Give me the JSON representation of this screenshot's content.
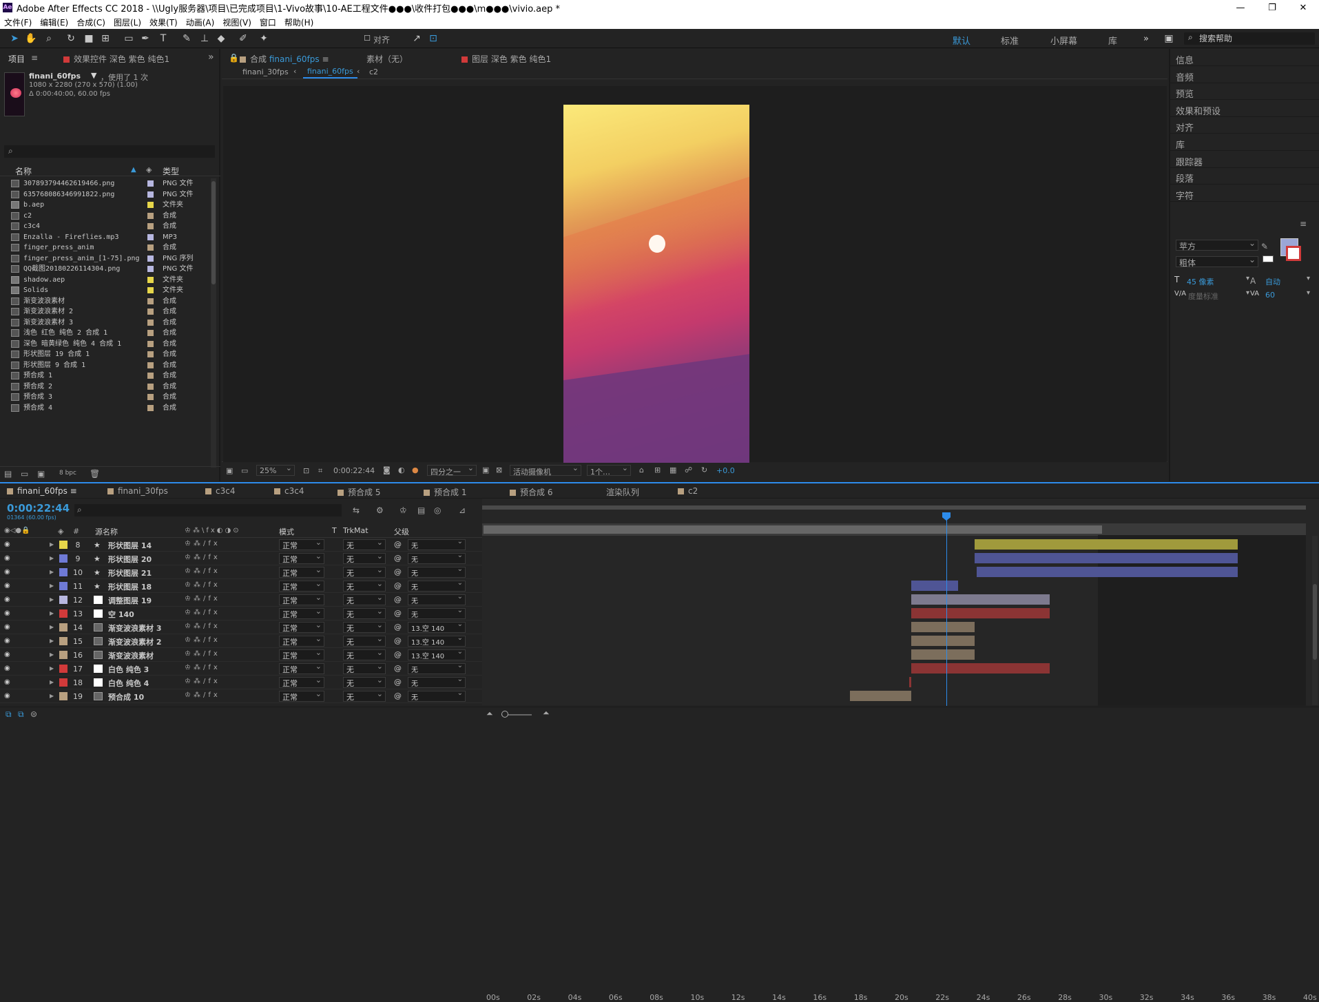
{
  "window": {
    "title": "Adobe After Effects CC 2018 - \\\\Ugly服务器\\项目\\已完成项目\\1-Vivo故事\\10-AE工程文件●●●\\收件打包●●●\\m●●●\\vivio.aep *",
    "logo": "Ae",
    "minimize": "—",
    "maximize": "❐",
    "close": "✕"
  },
  "menu": [
    "文件(F)",
    "编辑(E)",
    "合成(C)",
    "图层(L)",
    "效果(T)",
    "动画(A)",
    "视图(V)",
    "窗口",
    "帮助(H)"
  ],
  "toolbar": {
    "align_label": "对齐",
    "workspaces": [
      "默认",
      "标准",
      "小屏幕",
      "库"
    ],
    "active_workspace": "默认",
    "search_placeholder": "搜索帮助"
  },
  "project_panel": {
    "tab": "项目",
    "effects_tab": "效果控件 深色 紫色 纯色1",
    "item_name": "finani_60fps",
    "item_used": "，使用了 1 次",
    "item_dims": "1080 x 2280 (270 x 570) (1.00)",
    "item_time": "Δ 0:00:40:00, 60.00 fps",
    "col_name": "名称",
    "col_type": "类型",
    "bpc": "8 bpc",
    "items": [
      {
        "name": "307893794462619466.png",
        "type": "PNG 文件",
        "color": "#b7b7e0"
      },
      {
        "name": "635768086346991822.png",
        "type": "PNG 文件",
        "color": "#b7b7e0"
      },
      {
        "name": "b.aep",
        "type": "文件夹",
        "color": "#e6d64a",
        "folder": true
      },
      {
        "name": "c2",
        "type": "合成",
        "color": "#b8a080"
      },
      {
        "name": "c3c4",
        "type": "合成",
        "color": "#b8a080"
      },
      {
        "name": "Enzalla - Fireflies.mp3",
        "type": "MP3",
        "color": "#b7b7e0"
      },
      {
        "name": "finger_press_anim",
        "type": "合成",
        "color": "#b8a080"
      },
      {
        "name": "finger_press_anim_[1-75].png",
        "type": "PNG 序列",
        "color": "#b7b7e0"
      },
      {
        "name": "QQ截图20180226114304.png",
        "type": "PNG 文件",
        "color": "#b7b7e0"
      },
      {
        "name": "shadow.aep",
        "type": "文件夹",
        "color": "#e6d64a",
        "folder": true
      },
      {
        "name": "Solids",
        "type": "文件夹",
        "color": "#e6d64a",
        "folder": true
      },
      {
        "name": "渐变波浪素材",
        "type": "合成",
        "color": "#b8a080"
      },
      {
        "name": "渐变波浪素材 2",
        "type": "合成",
        "color": "#b8a080"
      },
      {
        "name": "渐变波浪素材 3",
        "type": "合成",
        "color": "#b8a080"
      },
      {
        "name": "浅色 红色 纯色 2 合成 1",
        "type": "合成",
        "color": "#b8a080"
      },
      {
        "name": "深色 暗黄绿色 纯色 4 合成 1",
        "type": "合成",
        "color": "#b8a080"
      },
      {
        "name": "形状图层 19 合成 1",
        "type": "合成",
        "color": "#b8a080"
      },
      {
        "name": "形状图层 9 合成 1",
        "type": "合成",
        "color": "#b8a080"
      },
      {
        "name": "预合成 1",
        "type": "合成",
        "color": "#b8a080"
      },
      {
        "name": "预合成 2",
        "type": "合成",
        "color": "#b8a080"
      },
      {
        "name": "预合成 3",
        "type": "合成",
        "color": "#b8a080"
      },
      {
        "name": "预合成 4",
        "type": "合成",
        "color": "#b8a080"
      }
    ]
  },
  "composition_panel": {
    "tab_prefix": "合成",
    "tab_comp": "finani_60fps",
    "footage_tab": "素材（无）",
    "layer_tab": "图层 深色 紫色 纯色1",
    "breadcrumbs": [
      "finani_30fps",
      "finani_60fps",
      "c2"
    ],
    "zoom": "25%",
    "time": "0:00:22:44",
    "resolution": "四分之一",
    "camera": "活动摄像机",
    "views": "1个…",
    "exposure": "+0.0"
  },
  "right_panels": [
    "信息",
    "音频",
    "预览",
    "效果和预设",
    "对齐",
    "库",
    "跟踪器",
    "段落",
    "字符"
  ],
  "character": {
    "font": "苹方",
    "style": "粗体",
    "size": "45 像素",
    "leading": "自动",
    "kerning": "度量标准",
    "tracking": "60"
  },
  "timeline": {
    "tabs": [
      {
        "label": "finani_60fps",
        "color": "#b8a080"
      },
      {
        "label": "finani_30fps",
        "color": "#b8a080"
      },
      {
        "label": "c3c4",
        "color": "#b8a080"
      },
      {
        "label": "c3c4",
        "color": "#b8a080"
      },
      {
        "label": "预合成 5",
        "color": "#b8a080"
      },
      {
        "label": "预合成 1",
        "color": "#b8a080"
      },
      {
        "label": "预合成 6",
        "color": "#b8a080"
      },
      {
        "label": "渲染队列",
        "color": ""
      },
      {
        "label": "c2",
        "color": "#b8a080"
      }
    ],
    "time": "0:00:22:44",
    "frames": "01364 (60.00 fps)",
    "headers": {
      "source": "源名称",
      "mode": "模式",
      "t": "T",
      "trkmat": "TrkMat",
      "parent": "父级"
    },
    "ticks": [
      "00s",
      "02s",
      "04s",
      "06s",
      "08s",
      "10s",
      "12s",
      "14s",
      "16s",
      "18s",
      "20s",
      "22s",
      "24s",
      "26s",
      "28s",
      "30s",
      "32s",
      "34s",
      "36s",
      "38s",
      "40s"
    ],
    "layers": [
      {
        "num": "8",
        "name": "形状图层 14",
        "color": "#e6d64a",
        "kind": "star",
        "mode": "正常",
        "trk": "无",
        "parent": "无",
        "bar_start": 23.9,
        "bar_end": 36.8,
        "bar_color": "#a09a3c"
      },
      {
        "num": "9",
        "name": "形状图层 20",
        "color": "#6f7ad6",
        "kind": "star",
        "mode": "正常",
        "trk": "无",
        "parent": "无",
        "bar_start": 23.9,
        "bar_end": 36.8,
        "bar_color": "#4f5595"
      },
      {
        "num": "10",
        "name": "形状图层 21",
        "color": "#6f7ad6",
        "kind": "star",
        "mode": "正常",
        "trk": "无",
        "parent": "无",
        "bar_start": 24.0,
        "bar_end": 36.8,
        "bar_color": "#4f5595"
      },
      {
        "num": "11",
        "name": "形状图层 18",
        "color": "#6f7ad6",
        "kind": "star",
        "mode": "正常",
        "trk": "无",
        "parent": "无",
        "bar_start": 20.8,
        "bar_end": 23.1,
        "bar_color": "#4f5595"
      },
      {
        "num": "12",
        "name": "调整图层 19",
        "color": "#b7b7e0",
        "kind": "white",
        "mode": "正常",
        "trk": "无",
        "parent": "无",
        "bar_start": 20.8,
        "bar_end": 27.6,
        "bar_color": "#7d7a8e"
      },
      {
        "num": "13",
        "name": "空 140",
        "color": "#d13a3a",
        "kind": "white",
        "mode": "正常",
        "trk": "无",
        "parent": "无",
        "bar_start": 20.8,
        "bar_end": 27.6,
        "bar_color": "#8b3434"
      },
      {
        "num": "14",
        "name": "渐变波浪素材 3",
        "color": "#b8a080",
        "kind": "comp",
        "mode": "正常",
        "trk": "无",
        "parent": "13.空 140",
        "bar_start": 20.8,
        "bar_end": 23.9,
        "bar_color": "#7c6e5c"
      },
      {
        "num": "15",
        "name": "渐变波浪素材 2",
        "color": "#b8a080",
        "kind": "comp",
        "mode": "正常",
        "trk": "无",
        "parent": "13.空 140",
        "bar_start": 20.8,
        "bar_end": 23.9,
        "bar_color": "#7c6e5c"
      },
      {
        "num": "16",
        "name": "渐变波浪素材",
        "color": "#b8a080",
        "kind": "comp",
        "mode": "正常",
        "trk": "无",
        "parent": "13.空 140",
        "bar_start": 20.8,
        "bar_end": 23.9,
        "bar_color": "#7c6e5c"
      },
      {
        "num": "17",
        "name": "白色 纯色 3",
        "color": "#d13a3a",
        "kind": "white",
        "mode": "正常",
        "trk": "无",
        "parent": "无",
        "bar_start": 20.8,
        "bar_end": 27.6,
        "bar_color": "#8b3434"
      },
      {
        "num": "18",
        "name": "白色 纯色 4",
        "color": "#d13a3a",
        "kind": "white",
        "mode": "正常",
        "trk": "无",
        "parent": "无",
        "bar_start": 20.7,
        "bar_end": 20.8,
        "bar_color": "#8b3434"
      },
      {
        "num": "19",
        "name": "预合成 10",
        "color": "#b8a080",
        "kind": "comp",
        "mode": "正常",
        "trk": "无",
        "parent": "无",
        "bar_start": 17.8,
        "bar_end": 20.8,
        "bar_color": "#7c6e5c"
      }
    ]
  },
  "colors": {
    "accent": "#2d8ceb",
    "ui_bg": "#232323"
  }
}
